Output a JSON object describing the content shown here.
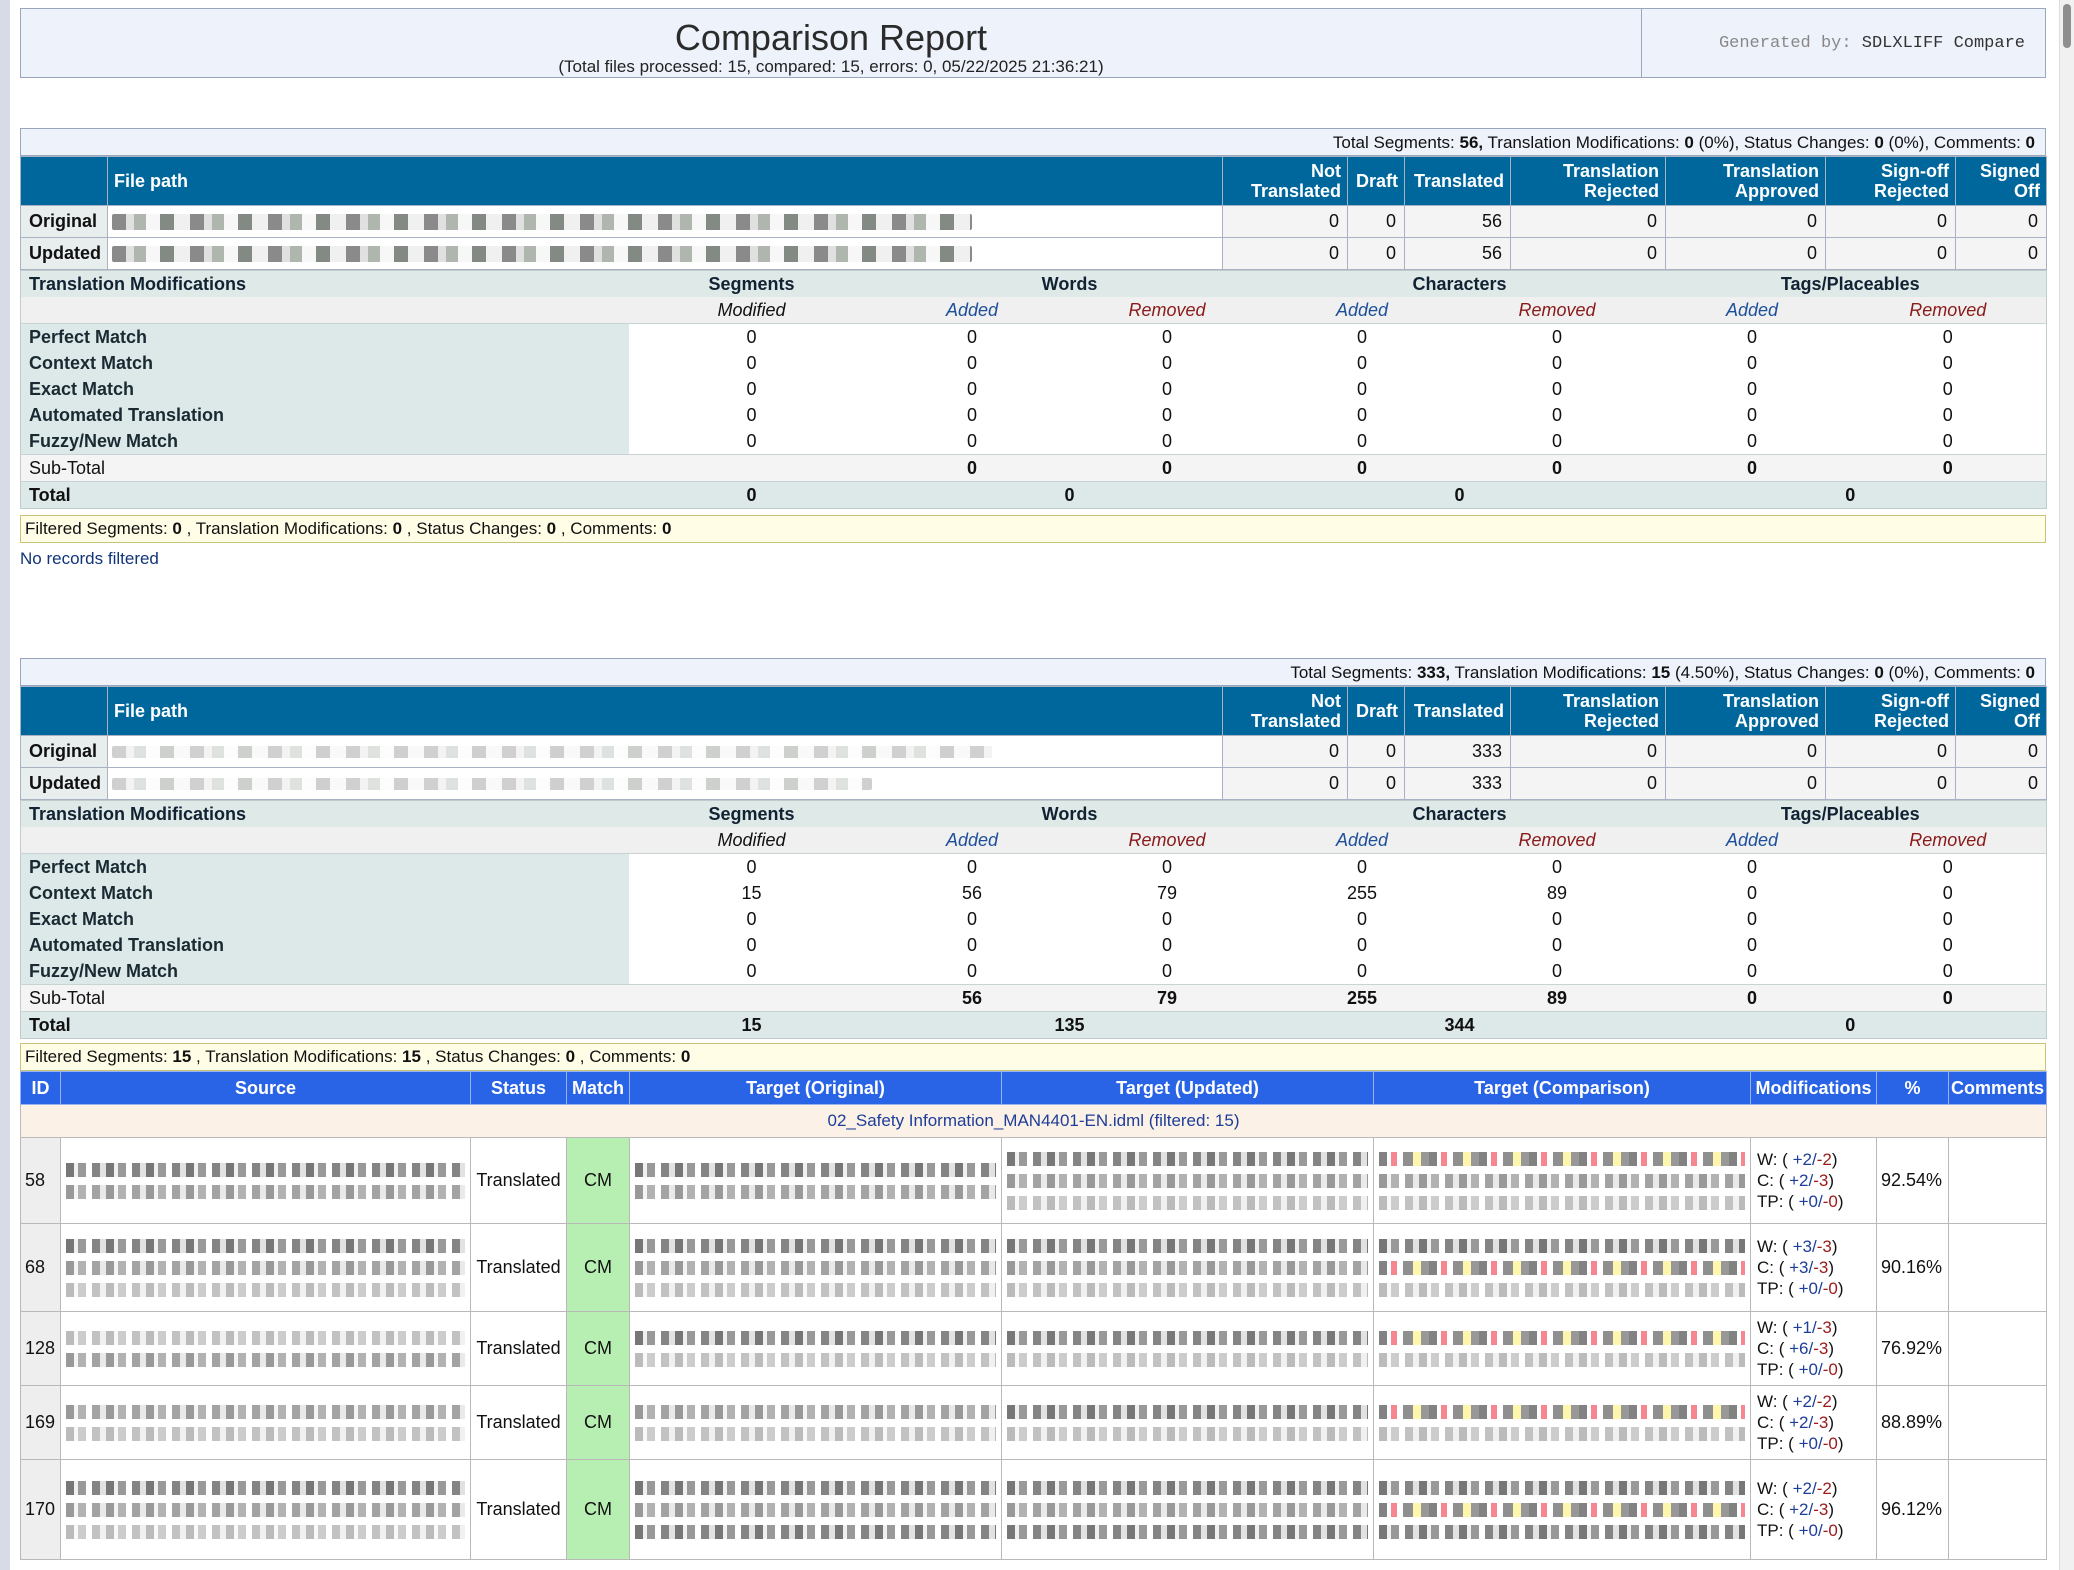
{
  "header": {
    "title": "Comparison Report",
    "subtitle": "(Total files processed: 15,  compared: 15,  errors: 0,  05/22/2025 21:36:21)",
    "generated_label": "Generated by:",
    "generated_by": "SDLXLIFF Compare"
  },
  "file_table_headers": {
    "file_path": "File path",
    "not_translated": "Not Translated",
    "draft": "Draft",
    "translated": "Translated",
    "translation_rejected": "Translation Rejected",
    "translation_approved": "Translation Approved",
    "signoff_rejected": "Sign-off Rejected",
    "signed_off": "Signed Off"
  },
  "mods_headers": {
    "title": "Translation Modifications",
    "segments": "Segments",
    "words": "Words",
    "characters": "Characters",
    "tags": "Tags/Placeables",
    "modified": "Modified",
    "added": "Added",
    "removed": "Removed"
  },
  "row_labels": {
    "original": "Original",
    "updated": "Updated",
    "perfect": "Perfect Match",
    "context": "Context Match",
    "exact": "Exact Match",
    "automated": "Automated Translation",
    "fuzzy": "Fuzzy/New Match",
    "subtotal": "Sub-Total",
    "total": "Total"
  },
  "file1": {
    "summary_parts": [
      "Total Segments: ",
      "56,",
      " Translation Modifications: ",
      "0",
      " (0%),  Status Changes: ",
      "0",
      " (0%),  Comments: ",
      "0"
    ],
    "original": [
      "0",
      "0",
      "56",
      "0",
      "0",
      "0",
      "0"
    ],
    "updated": [
      "0",
      "0",
      "56",
      "0",
      "0",
      "0",
      "0"
    ],
    "mods": {
      "perfect": [
        "0",
        "0",
        "0",
        "0",
        "0",
        "0",
        "0"
      ],
      "context": [
        "0",
        "0",
        "0",
        "0",
        "0",
        "0",
        "0"
      ],
      "exact": [
        "0",
        "0",
        "0",
        "0",
        "0",
        "0",
        "0"
      ],
      "automated": [
        "0",
        "0",
        "0",
        "0",
        "0",
        "0",
        "0"
      ],
      "fuzzy": [
        "0",
        "0",
        "0",
        "0",
        "0",
        "0",
        "0"
      ],
      "subtotal": [
        "0",
        "0",
        "0",
        "0",
        "0",
        "0"
      ],
      "total": [
        "0",
        "0",
        "0",
        "0"
      ]
    },
    "filter_parts": [
      "Filtered Segments: ",
      "0",
      " , Translation Modifications: ",
      "0",
      " , Status Changes: ",
      "0",
      " , Comments: ",
      "0"
    ],
    "no_records": "No records filtered"
  },
  "file2": {
    "summary_parts": [
      "Total Segments: ",
      "333,",
      " Translation Modifications: ",
      "15",
      " (4.50%),  Status Changes: ",
      "0",
      " (0%),  Comments: ",
      "0"
    ],
    "original": [
      "0",
      "0",
      "333",
      "0",
      "0",
      "0",
      "0"
    ],
    "updated": [
      "0",
      "0",
      "333",
      "0",
      "0",
      "0",
      "0"
    ],
    "mods": {
      "perfect": [
        "0",
        "0",
        "0",
        "0",
        "0",
        "0",
        "0"
      ],
      "context": [
        "15",
        "56",
        "79",
        "255",
        "89",
        "0",
        "0"
      ],
      "exact": [
        "0",
        "0",
        "0",
        "0",
        "0",
        "0",
        "0"
      ],
      "automated": [
        "0",
        "0",
        "0",
        "0",
        "0",
        "0",
        "0"
      ],
      "fuzzy": [
        "0",
        "0",
        "0",
        "0",
        "0",
        "0",
        "0"
      ],
      "subtotal": [
        "56",
        "79",
        "255",
        "89",
        "0",
        "0"
      ],
      "total": [
        "15",
        "135",
        "344",
        "0"
      ]
    },
    "filter_parts": [
      "Filtered Segments: ",
      "15",
      " , Translation Modifications: ",
      "15",
      " , Status Changes: ",
      "0",
      " , Comments: ",
      "0"
    ]
  },
  "segments_table": {
    "headers": [
      "ID",
      "Source",
      "Status",
      "Match",
      "Target (Original)",
      "Target (Updated)",
      "Target (Comparison)",
      "Modifications",
      "%",
      "Comments"
    ],
    "file_name_row": "02_Safety Information_MAN4401-EN.idml  (filtered: 15)",
    "rows": [
      {
        "id": "58",
        "status": "Translated",
        "match": "CM",
        "w": [
          "W: (",
          "+2/",
          "-2",
          ")"
        ],
        "c": [
          "C: (",
          "+2/",
          "-3",
          ")"
        ],
        "tp": [
          "TP: (",
          "+0/",
          "-0",
          ")"
        ],
        "pct": "92.54%"
      },
      {
        "id": "68",
        "status": "Translated",
        "match": "CM",
        "w": [
          "W: (",
          "+3/",
          "-3",
          ")"
        ],
        "c": [
          "C: (",
          "+3/",
          "-3",
          ")"
        ],
        "tp": [
          "TP: (",
          "+0/",
          "-0",
          ")"
        ],
        "pct": "90.16%"
      },
      {
        "id": "128",
        "status": "Translated",
        "match": "CM",
        "w": [
          "W: (",
          "+1/",
          "-3",
          ")"
        ],
        "c": [
          "C: (",
          "+6/",
          "-3",
          ")"
        ],
        "tp": [
          "TP: (",
          "+0/",
          "-0",
          ")"
        ],
        "pct": "76.92%"
      },
      {
        "id": "169",
        "status": "Translated",
        "match": "CM",
        "w": [
          "W: (",
          "+2/",
          "-2",
          ")"
        ],
        "c": [
          "C: (",
          "+2/",
          "-3",
          ")"
        ],
        "tp": [
          "TP: (",
          "+0/",
          "-0",
          ")"
        ],
        "pct": "88.89%"
      },
      {
        "id": "170",
        "status": "Translated",
        "match": "CM",
        "w": [
          "W: (",
          "+2/",
          "-2",
          ")"
        ],
        "c": [
          "C: (",
          "+2/",
          "-3",
          ")"
        ],
        "tp": [
          "TP: (",
          "+0/",
          "-0",
          ")"
        ],
        "pct": "96.12%"
      }
    ]
  }
}
